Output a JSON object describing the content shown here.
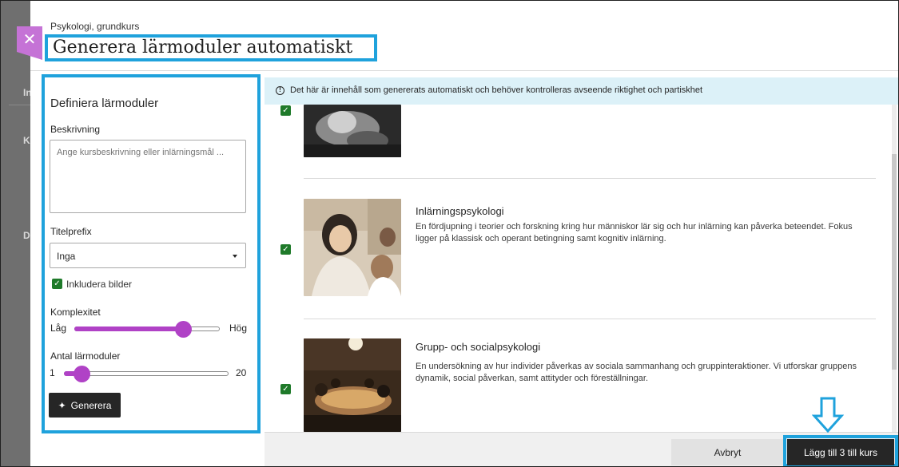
{
  "background": {
    "items": [
      "In",
      "K",
      "D"
    ]
  },
  "header": {
    "close_icon": "close-icon",
    "course_name": "Psykologi, grundkurs",
    "title": "Generera lärmoduler automatiskt"
  },
  "form": {
    "heading": "Definiera lärmoduler",
    "description_label": "Beskrivning",
    "description_placeholder": "Ange kursbeskrivning eller inlärningsmål ...",
    "prefix_label": "Titelprefix",
    "prefix_value": "Inga",
    "include_images_label": "Inkludera bilder",
    "include_images_checked": true,
    "complexity_label": "Komplexitet",
    "complexity_min_label": "Låg",
    "complexity_max_label": "Hög",
    "complexity_level": 0.75,
    "count_label": "Antal lärmoduler",
    "count_min": "1",
    "count_max": "20",
    "count_value": 3,
    "generate_button": "Generera",
    "accent_color": "#b042c6"
  },
  "notice": {
    "icon": "info-icon",
    "text": "Det här är innehåll som genererats automatiskt och behöver kontrolleras avseende riktighet och partiskhet"
  },
  "modules": [
    {
      "title": "",
      "description": "",
      "checked": true
    },
    {
      "title": "Inlärningspsykologi",
      "description": "En fördjupning i teorier och forskning kring hur människor lär sig och hur inlärning kan påverka beteendet. Fokus ligger på klassisk och operant betingning samt kognitiv inlärning.",
      "checked": true
    },
    {
      "title": "Grupp- och socialpsykologi",
      "description": "En undersökning av hur individer påverkas av sociala sammanhang och gruppinteraktioner. Vi utforskar gruppens dynamik, social påverkan, samt attityder och föreställningar.",
      "checked": true
    }
  ],
  "footer": {
    "cancel_button": "Avbryt",
    "add_button": "Lägg till 3 till kurs"
  },
  "colors": {
    "highlight": "#1fa2dc",
    "notice_bg": "#dcf1f8",
    "check_green": "#1f7a2a",
    "close_bg": "#c573d6"
  }
}
